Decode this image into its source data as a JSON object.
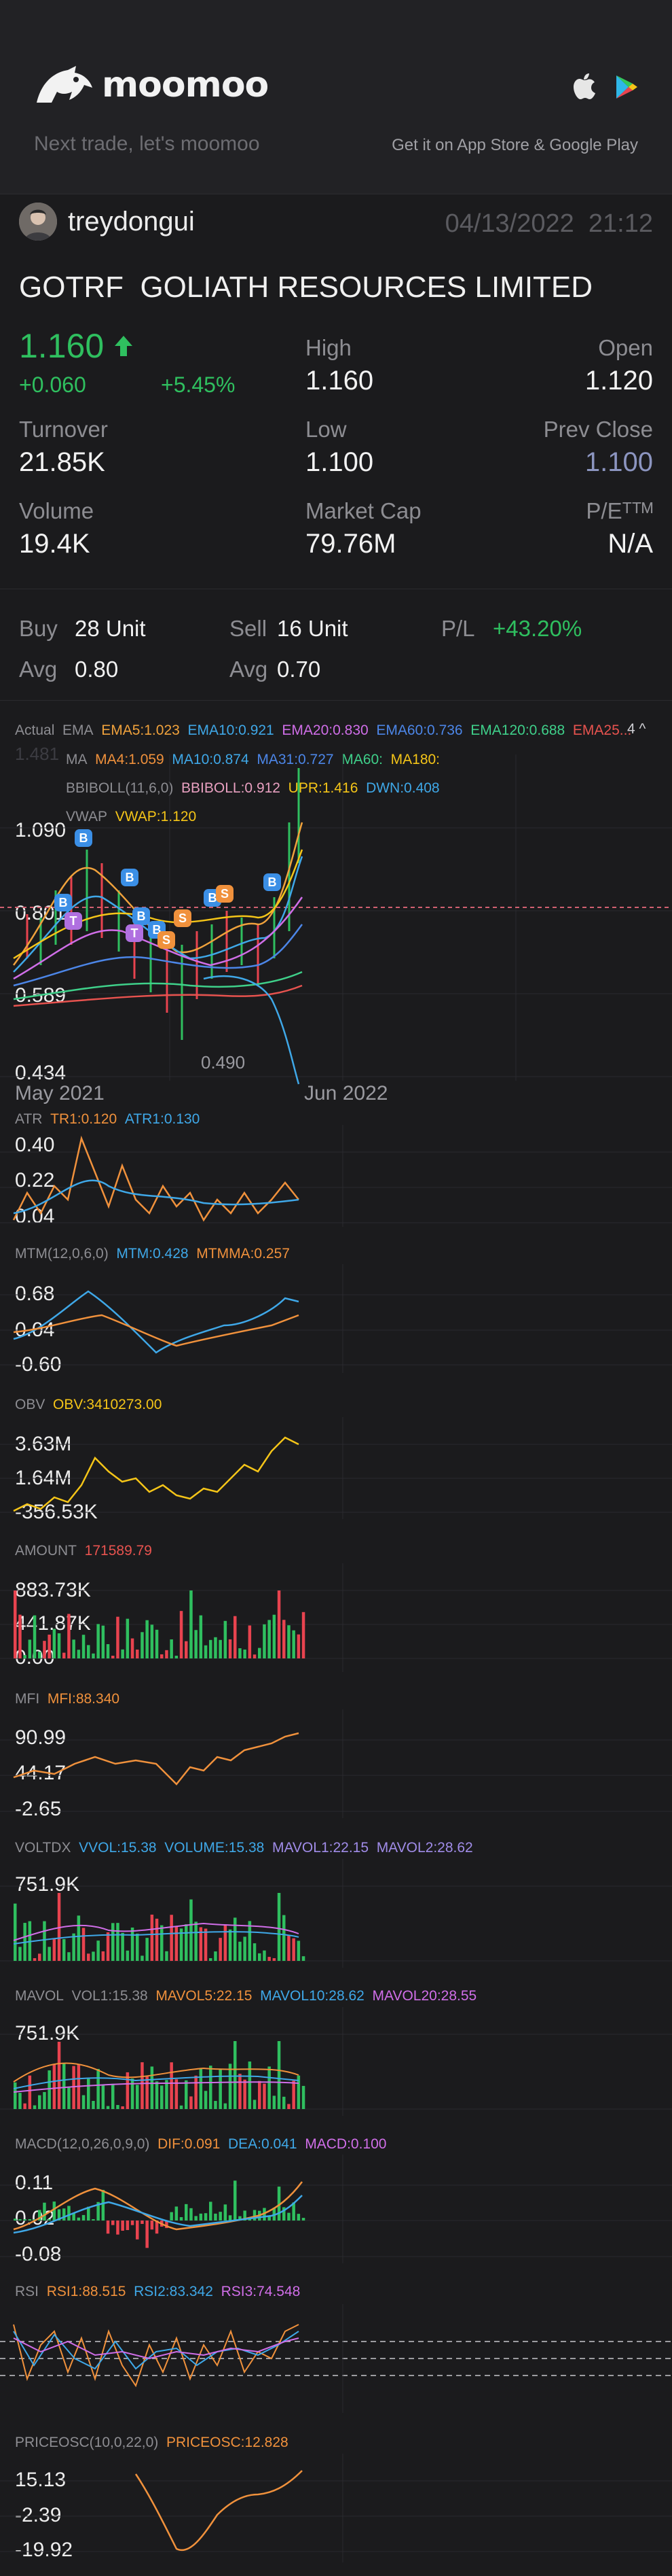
{
  "header": {
    "brand": "moomoo",
    "slogan": "Next trade, let's moomoo",
    "store_text": "Get it on App Store & Google Play"
  },
  "user": {
    "name": "treydongui",
    "date": "04/13/2022",
    "time": "21:12"
  },
  "stock": {
    "ticker": "GOTRF",
    "name": "GOLIATH RESOURCES LIMITED",
    "price": "1.160",
    "change": "+0.060",
    "change_pct": "+5.45%",
    "high_label": "High",
    "high": "1.160",
    "open_label": "Open",
    "open": "1.120",
    "turnover_label": "Turnover",
    "turnover": "21.85K",
    "low_label": "Low",
    "low": "1.100",
    "prev_close_label": "Prev Close",
    "prev_close": "1.100",
    "volume_label": "Volume",
    "volume": "19.4K",
    "mcap_label": "Market Cap",
    "mcap": "79.76M",
    "pe_label": "P/Eᵀᵀᴹ",
    "pe": "N/A"
  },
  "trade": {
    "buy_label": "Buy",
    "buy_units": "28 Unit",
    "sell_label": "Sell",
    "sell_units": "16 Unit",
    "pl_label": "P/L",
    "pl": "+43.20%",
    "avg_label": "Avg",
    "buy_avg": "0.80",
    "sell_avg": "0.70"
  },
  "main_chart": {
    "ema_row": [
      "Actual",
      "EMA",
      "EMA5:1.023",
      "EMA10:0.921",
      "EMA20:0.830",
      "EMA60:0.736",
      "EMA120:0.688",
      "EMA25..."
    ],
    "ma_row": [
      "MA",
      "MA4:1.059",
      "MA10:0.874",
      "MA31:0.727",
      "MA60:",
      "MA180:"
    ],
    "boll_row": [
      "BBIBOLL(11,6,0)",
      "BBIBOLL:0.912",
      "UPR:1.416",
      "DWN:0.408"
    ],
    "vwap_row": [
      "VWAP",
      "VWAP:1.120"
    ],
    "collapse_num": "4",
    "y_labels": [
      "1.481",
      "1.090",
      "0.801",
      "0.589",
      "0.434"
    ],
    "low_mark": "0.490",
    "x_start": "May 2021",
    "x_end": "Jun 2022",
    "colors": {
      "up": "#2fbf5f",
      "down": "#e8434f",
      "buy_marker": "#3b8fe6",
      "sell_marker": "#f0913c"
    }
  },
  "indicators": {
    "atr": {
      "name": "ATR",
      "v1": "TR1:0.120",
      "v2": "ATR1:0.130",
      "y": [
        "0.40",
        "0.22",
        "0.04"
      ]
    },
    "mtm": {
      "name": "MTM(12,0,6,0)",
      "v1": "MTM:0.428",
      "v2": "MTMMA:0.257",
      "y": [
        "0.68",
        "0.04",
        "-0.60"
      ]
    },
    "obv": {
      "name": "OBV",
      "v1": "OBV:3410273.00",
      "y": [
        "3.63M",
        "1.64M",
        "-356.53K"
      ]
    },
    "amount": {
      "name": "AMOUNT",
      "v1": "171589.79",
      "y": [
        "883.73K",
        "441.87K",
        "0.00"
      ]
    },
    "mfi": {
      "name": "MFI",
      "v1": "MFI:88.340",
      "y": [
        "90.99",
        "44.17",
        "-2.65"
      ]
    },
    "voltdx": {
      "name": "VOLTDX",
      "v1": "VVOL:15.38",
      "v2": "VOLUME:15.38",
      "v3": "MAVOL1:22.15",
      "v4": "MAVOL2:28.62",
      "y": [
        "751.9K"
      ]
    },
    "mavol": {
      "name": "MAVOL",
      "v1": "VOL1:15.38",
      "v2": "MAVOL5:22.15",
      "v3": "MAVOL10:28.62",
      "v4": "MAVOL20:28.55",
      "y": [
        "751.9K"
      ]
    },
    "macd": {
      "name": "MACD(12,0,26,0,9,0)",
      "v1": "DIF:0.091",
      "v2": "DEA:0.041",
      "v3": "MACD:0.100",
      "y": [
        "0.11",
        "0.02",
        "-0.08"
      ]
    },
    "rsi": {
      "name": "RSI",
      "v1": "RSI1:88.515",
      "v2": "RSI2:83.342",
      "v3": "RSI3:74.548"
    },
    "priceosc": {
      "name": "PRICEOSC(10,0,22,0)",
      "v1": "PRICEOSC:12.828",
      "y": [
        "15.13",
        "-2.39",
        "-19.92"
      ]
    }
  }
}
